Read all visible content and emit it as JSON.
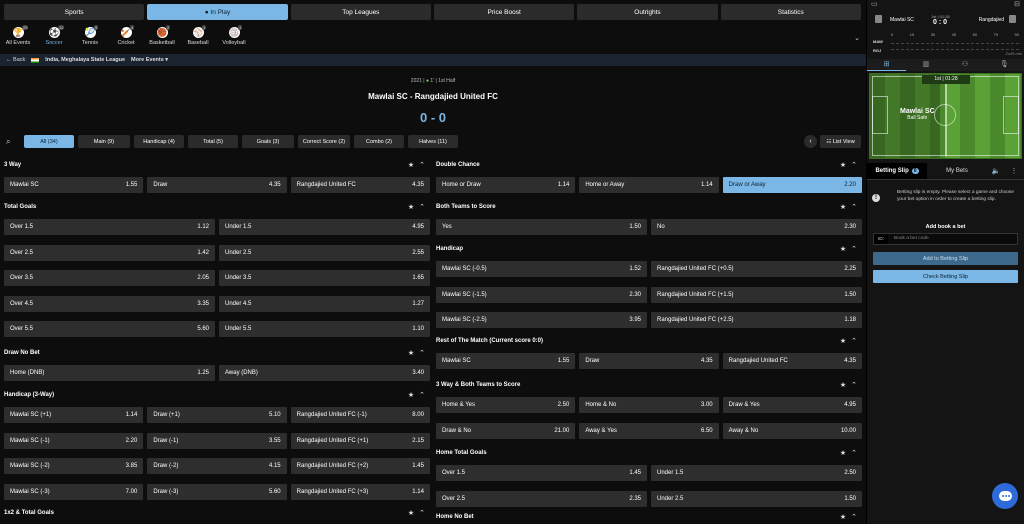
{
  "top_nav": [
    {
      "label": "Sports",
      "active": false
    },
    {
      "label": "● In Play",
      "active": true
    },
    {
      "label": "Top Leagues",
      "active": false
    },
    {
      "label": "Price Boost",
      "active": false
    },
    {
      "label": "Outrights",
      "active": false
    },
    {
      "label": "Statistics",
      "active": false
    }
  ],
  "sports": [
    {
      "label": "All Events",
      "count": "25",
      "icon": "trophy-icon",
      "glyph": "🏆"
    },
    {
      "label": "Soccer",
      "count": "12",
      "icon": "soccer-icon",
      "glyph": "⚽",
      "active": true
    },
    {
      "label": "Tennis",
      "count": "9",
      "icon": "tennis-icon",
      "glyph": "🎾"
    },
    {
      "label": "Cricket",
      "count": "4",
      "icon": "cricket-icon",
      "glyph": "🏏"
    },
    {
      "label": "Basketball",
      "count": "2",
      "icon": "basketball-icon",
      "glyph": "🏀"
    },
    {
      "label": "Baseball",
      "count": "1",
      "icon": "baseball-icon",
      "glyph": "⚾"
    },
    {
      "label": "Volleyball",
      "count": "1",
      "icon": "volleyball-icon",
      "glyph": "🏐"
    }
  ],
  "breadcrumb": {
    "back": "← Back",
    "league": "India, Meghalaya State League",
    "more": "More Events ▾"
  },
  "match": {
    "meta_year": "2021",
    "meta_min": "1'",
    "meta_half": "1st Half",
    "title": "Mawlai SC - Rangdajied United FC",
    "score": "0 - 0"
  },
  "tabs": [
    "All (34)",
    "Main (9)",
    "Handicap (4)",
    "Total (5)",
    "Goals (3)",
    "Correct Score (2)",
    "Combo (2)",
    "Halves (11)"
  ],
  "list_view": "☷ List View",
  "left_markets": [
    {
      "title": "3 Way",
      "cols": 3,
      "rows": [
        [
          [
            "Mawlai SC",
            "1.55"
          ],
          [
            "Draw",
            "4.35"
          ],
          [
            "Rangdajied United FC",
            "4.35"
          ]
        ]
      ]
    },
    {
      "title": "Total Goals",
      "cols": 2,
      "rows": [
        [
          [
            "Over 1.5",
            "1.12"
          ],
          [
            "Under 1.5",
            "4.95"
          ]
        ],
        [
          [
            "Over 2.5",
            "1.42"
          ],
          [
            "Under 2.5",
            "2.55"
          ]
        ],
        [
          [
            "Over 3.5",
            "2.05"
          ],
          [
            "Under 3.5",
            "1.65"
          ]
        ],
        [
          [
            "Over 4.5",
            "3.35"
          ],
          [
            "Under 4.5",
            "1.27"
          ]
        ],
        [
          [
            "Over 5.5",
            "5.60"
          ],
          [
            "Under 5.5",
            "1.10"
          ]
        ]
      ]
    },
    {
      "title": "Draw No Bet",
      "cols": 2,
      "rows": [
        [
          [
            "Home (DNB)",
            "1.25"
          ],
          [
            "Away (DNB)",
            "3.40"
          ]
        ]
      ]
    },
    {
      "title": "Handicap (3-Way)",
      "cols": 3,
      "rows": [
        [
          [
            "Mawlai SC (+1)",
            "1.14"
          ],
          [
            "Draw (+1)",
            "5.10"
          ],
          [
            "Rangdajied United FC (-1)",
            "8.00"
          ]
        ],
        [
          [
            "Mawlai SC (-1)",
            "2.20"
          ],
          [
            "Draw (-1)",
            "3.55"
          ],
          [
            "Rangdajied United FC (+1)",
            "2.15"
          ]
        ],
        [
          [
            "Mawlai SC (-2)",
            "3.85"
          ],
          [
            "Draw (-2)",
            "4.15"
          ],
          [
            "Rangdajied United FC (+2)",
            "1.45"
          ]
        ],
        [
          [
            "Mawlai SC (-3)",
            "7.00"
          ],
          [
            "Draw (-3)",
            "5.60"
          ],
          [
            "Rangdajied United FC (+3)",
            "1.14"
          ]
        ]
      ]
    },
    {
      "title": "1x2 & Total Goals",
      "cols": 3,
      "rows": []
    }
  ],
  "right_markets": [
    {
      "title": "Double Chance",
      "cols": 3,
      "rows": [
        [
          [
            "Home or Draw",
            "1.14"
          ],
          [
            "Home or Away",
            "1.14"
          ],
          [
            "Draw or Away",
            "2.20",
            true
          ]
        ]
      ]
    },
    {
      "title": "Both Teams to Score",
      "cols": 2,
      "rows": [
        [
          [
            "Yes",
            "1.50"
          ],
          [
            "No",
            "2.30"
          ]
        ]
      ]
    },
    {
      "title": "Handicap",
      "cols": 2,
      "rows": [
        [
          [
            "Mawlai SC (-0.5)",
            "1.52"
          ],
          [
            "Rangdajied United FC (+0.5)",
            "2.25"
          ]
        ],
        [
          [
            "Mawlai SC (-1.5)",
            "2.30"
          ],
          [
            "Rangdajied United FC (+1.5)",
            "1.50"
          ]
        ],
        [
          [
            "Mawlai SC (-2.5)",
            "3.95"
          ],
          [
            "Rangdajied United FC (+2.5)",
            "1.18"
          ]
        ]
      ]
    },
    {
      "title": "Rest of The Match (Current score 0:0)",
      "cols": 3,
      "rows": [
        [
          [
            "Mawlai SC",
            "1.55"
          ],
          [
            "Draw",
            "4.35"
          ],
          [
            "Rangdajied United FC",
            "4.35"
          ]
        ]
      ]
    },
    {
      "title": "3 Way & Both Teams to Score",
      "cols": 3,
      "rows": [
        [
          [
            "Home & Yes",
            "2.50"
          ],
          [
            "Home & No",
            "3.00"
          ],
          [
            "Draw & Yes",
            "4.95"
          ]
        ],
        [
          [
            "Draw & No",
            "21.00"
          ],
          [
            "Away & Yes",
            "6.50"
          ],
          [
            "Away & No",
            "10.00"
          ]
        ]
      ]
    },
    {
      "title": "Home Total Goals",
      "cols": 2,
      "rows": [
        [
          [
            "Over 1.5",
            "1.45"
          ],
          [
            "Under 1.5",
            "2.50"
          ]
        ],
        [
          [
            "Over 2.5",
            "2.35"
          ],
          [
            "Under 2.5",
            "1.50"
          ]
        ]
      ]
    },
    {
      "title": "Home No Bet",
      "cols": 2,
      "rows": []
    }
  ],
  "side": {
    "home": "Mawlai SC",
    "away": "Rangdajied",
    "time_label": "1st | 01:28",
    "score": "0 : 0",
    "tl_home": "MAW",
    "tl_away": "RGJ",
    "ticks": [
      "0",
      "15",
      "30",
      "45",
      "60",
      "75",
      "90"
    ],
    "added": "Zu45 min",
    "pitch_clock": "1st | 01:28",
    "pitch_team": "Mawlai SC",
    "pitch_state": "Ball Safe",
    "bs_label": "Betting Slip",
    "bs_count": "0",
    "my_bets": "My Bets",
    "empty_text": "Betting slip is empty. Please select a game and choose your bet option in order to create a betting slip.",
    "add_book": "Add book a bet",
    "book_lbl": "ID:",
    "book_ph": "Book a bet code",
    "add_btn": "Add to Betting Slip",
    "check_btn": "Check Betting Slip"
  },
  "colors": {
    "accent": "#7ab7e6",
    "button": "#2e2e2e",
    "bg": "#0d0d0d"
  }
}
